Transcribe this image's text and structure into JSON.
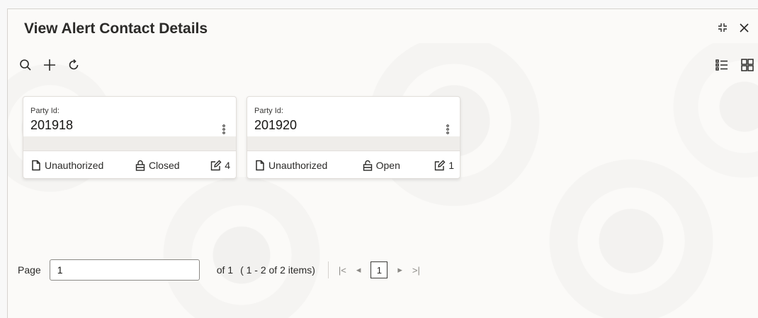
{
  "window": {
    "title": "View Alert Contact Details",
    "controls": [
      "minimize-icon",
      "close-icon"
    ]
  },
  "toolbar": {
    "icons": [
      "search-icon",
      "add-icon",
      "refresh-icon"
    ],
    "view_toggle": [
      "list-view-icon",
      "grid-view-icon"
    ]
  },
  "cards": [
    {
      "label": "Party Id:",
      "value": "201918",
      "record_status": "Unauthorized",
      "lock_status": "Closed",
      "lock_icon": "lock-closed-icon",
      "modification_count": "4"
    },
    {
      "label": "Party Id:",
      "value": "201920",
      "record_status": "Unauthorized",
      "lock_status": "Open",
      "lock_icon": "lock-open-icon",
      "modification_count": "1"
    }
  ],
  "pagination": {
    "page_label": "Page",
    "page_value": "1",
    "of_text": "of 1",
    "items_text": "( 1 - 2 of 2 items)",
    "first_glyph": "|<",
    "prev_glyph": "◂",
    "current_page": "1",
    "next_glyph": "▸",
    "last_glyph": ">|"
  },
  "colors": {
    "background": "#fbfaf8",
    "card": "#ffffff",
    "text": "#161513",
    "band": "#efedea"
  }
}
